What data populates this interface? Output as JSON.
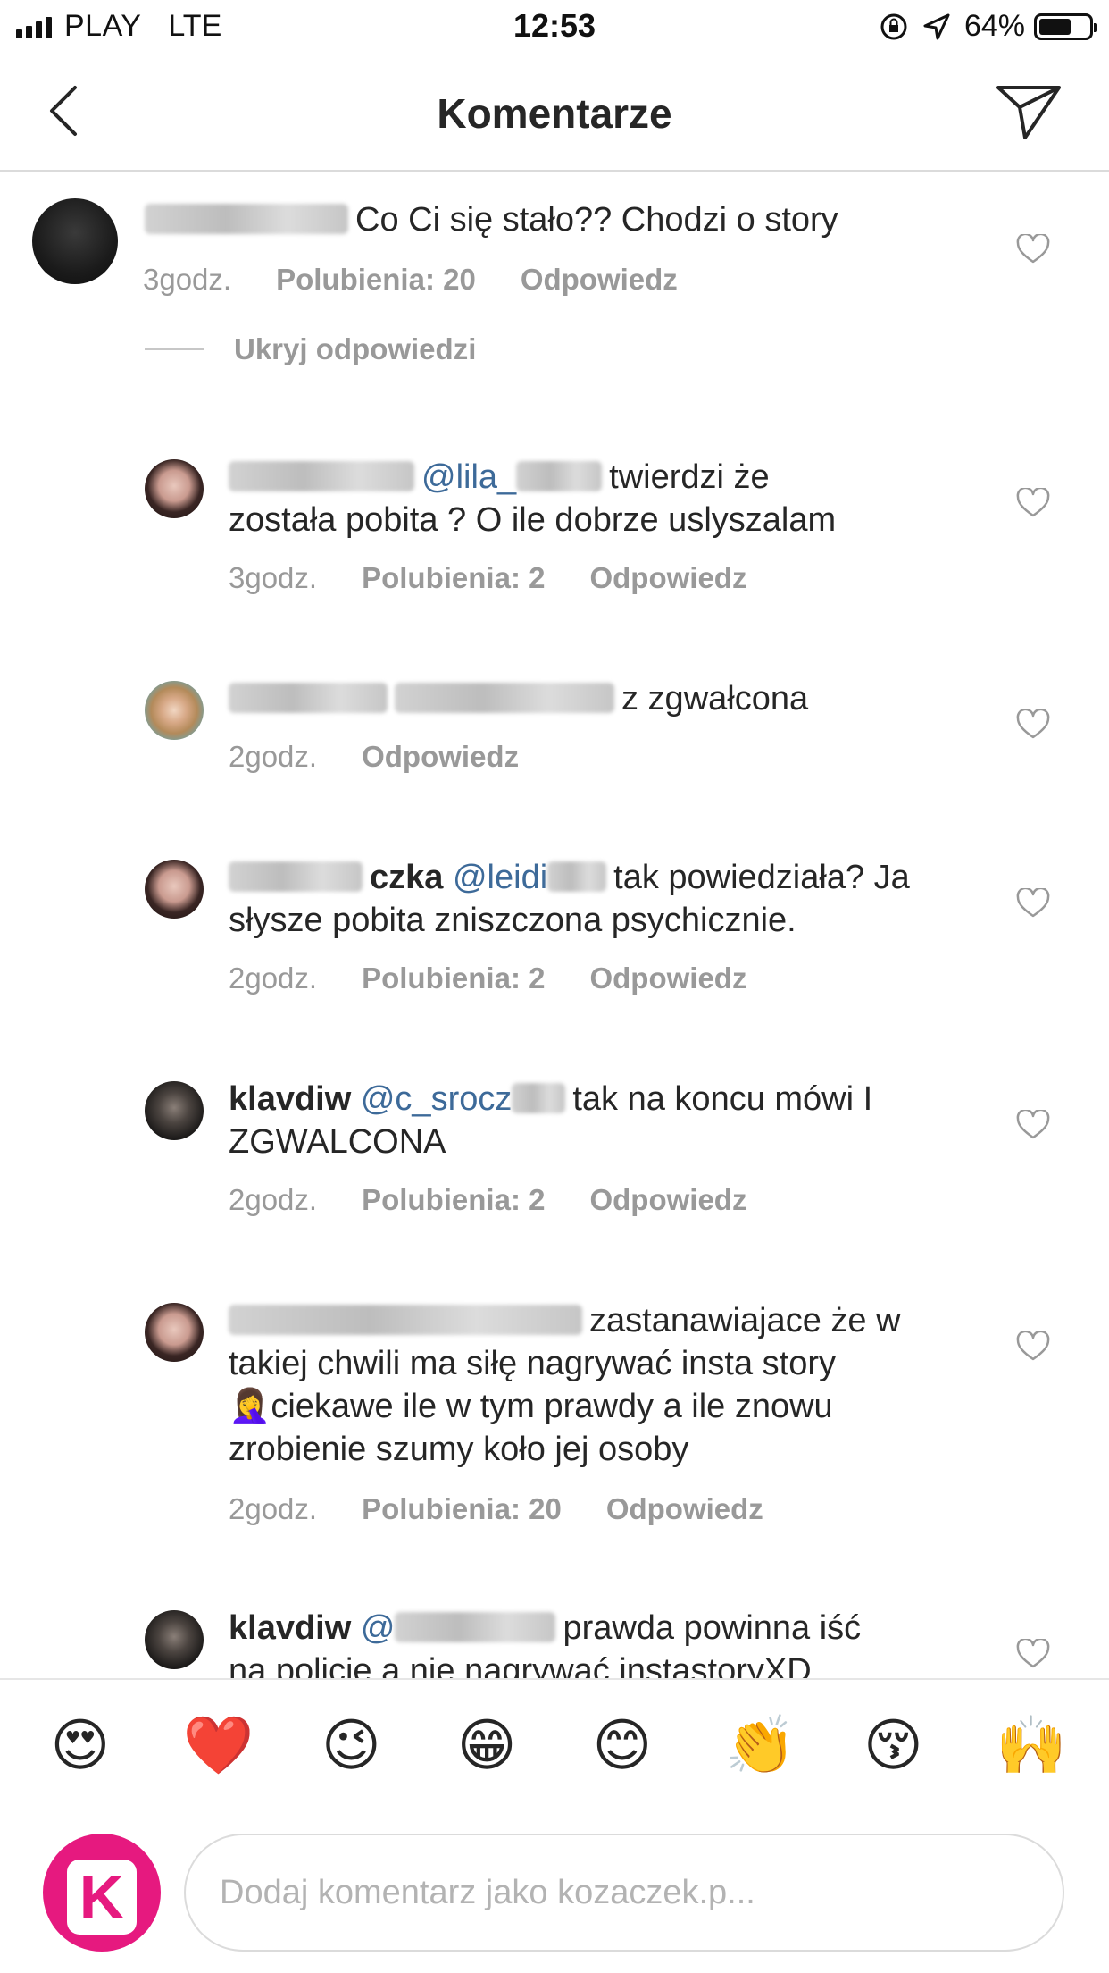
{
  "status_bar": {
    "carrier": "PLAY",
    "network": "LTE",
    "time": "12:53",
    "battery": "64%",
    "battery_level": 0.64
  },
  "nav": {
    "title": "Komentarze",
    "back_icon": "chevron-left-icon",
    "send_icon": "paper-plane-icon"
  },
  "main_comment": {
    "text": "Co Ci się stało?? Chodzi o story",
    "time": "3godz.",
    "likes": "Polubienia: 20",
    "reply": "Odpowiedz"
  },
  "hide_replies": "Ukryj odpowiedzi",
  "replies": [
    {
      "username": "",
      "mention": "@lila_",
      "text_line1": "twierdzi że",
      "text_line2": "została pobita ? O ile dobrze uslyszalam",
      "time": "3godz.",
      "likes": "Polubienia: 2",
      "reply": "Odpowiedz"
    },
    {
      "username": "",
      "mention": "",
      "text_line1": "z zgwałcona",
      "time": "2godz.",
      "reply": "Odpowiedz"
    },
    {
      "username": "czka",
      "mention": "@leidi",
      "text_line1": "tak powiedziała? Ja",
      "text_line2": "słysze pobita zniszczona psychicznie.",
      "time": "2godz.",
      "likes": "Polubienia: 2",
      "reply": "Odpowiedz"
    },
    {
      "username": "klavdiw",
      "mention": "@c_srocz",
      "text_line1": "tak na koncu mówi I",
      "text_line2": "ZGWALCONA",
      "time": "2godz.",
      "likes": "Polubienia: 2",
      "reply": "Odpowiedz"
    },
    {
      "username": "",
      "mention": "",
      "text_line1": "zastanawiajace że w",
      "text_line2": "takiej chwili ma siłę nagrywać insta story",
      "text_line3": "ciekawe ile w tym prawdy a ile znowu",
      "text_line4": "zrobienie szumy koło jej osoby",
      "emoji": "🤦‍♀️",
      "time": "2godz.",
      "likes": "Polubienia: 20",
      "reply": "Odpowiedz"
    },
    {
      "username": "klavdiw",
      "mention": "@",
      "text_line1": "prawda powinna iść",
      "text_line2": "na policie a nie nagrywać instastoryXD"
    }
  ],
  "emojis": [
    "😍",
    "❤️",
    "😉",
    "😁",
    "😊",
    "👏",
    "😚",
    "🙌"
  ],
  "input": {
    "placeholder": "Dodaj komentarz jako kozaczek.p...",
    "avatar_letter": "K"
  },
  "colors": {
    "text": "#262626",
    "meta": "#999999",
    "divider": "#dbdbdb",
    "brand_pink": "#e6197f"
  }
}
